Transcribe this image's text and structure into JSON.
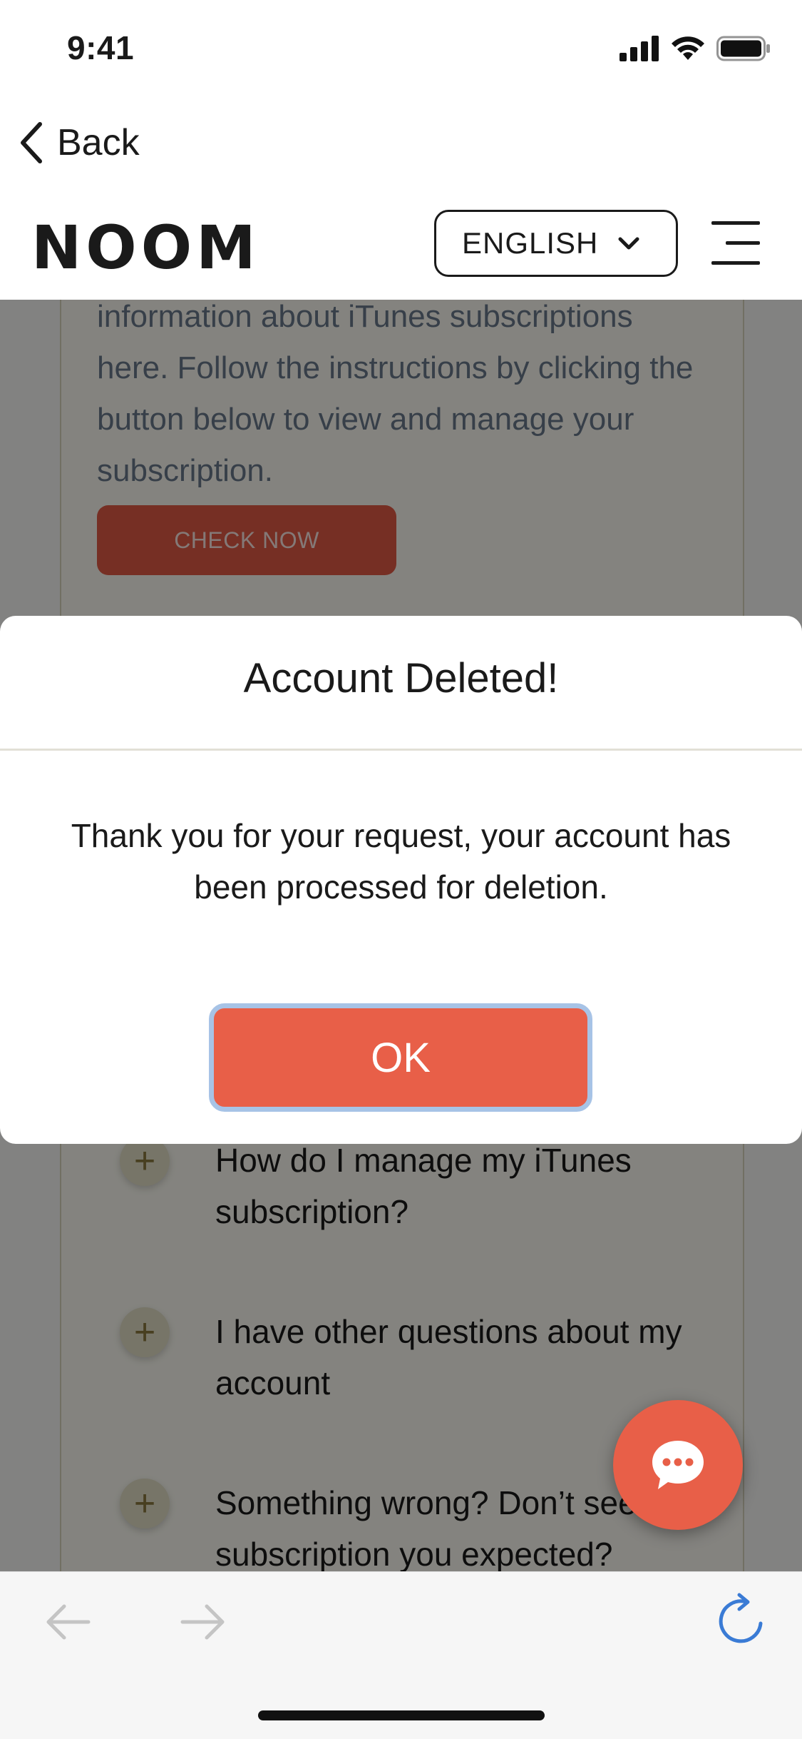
{
  "status_bar": {
    "time": "9:41",
    "icons": [
      "signal-icon",
      "wifi-icon",
      "battery-icon"
    ]
  },
  "nav": {
    "back_label": "Back"
  },
  "header": {
    "logo": "NOOM",
    "language": "ENGLISH"
  },
  "background": {
    "card_text": "information about iTunes subscriptions here. Follow the instructions by clicking the button below to view and manage your subscription.",
    "check_now_label": "CHECK NOW",
    "faq": [
      {
        "question": "How do I manage my iTunes subscription?"
      },
      {
        "question": "I have other questions about my account"
      },
      {
        "question": "Something wrong? Don’t see a subscription you expected?"
      }
    ],
    "faq_plus": "+"
  },
  "modal": {
    "title": "Account Deleted!",
    "body": "Thank you for your request, your account has been processed for deletion.",
    "ok_label": "OK"
  },
  "chat": {
    "icon": "chat-bubble-icon"
  },
  "browser": {
    "icons": [
      "arrow-left-icon",
      "arrow-right-icon",
      "reload-icon"
    ]
  },
  "colors": {
    "accent": "#e85f48",
    "focus_ring": "#a7c3e6",
    "overlay": "rgba(0,0,0,0.48)",
    "link_blue": "#3a7bd5"
  }
}
